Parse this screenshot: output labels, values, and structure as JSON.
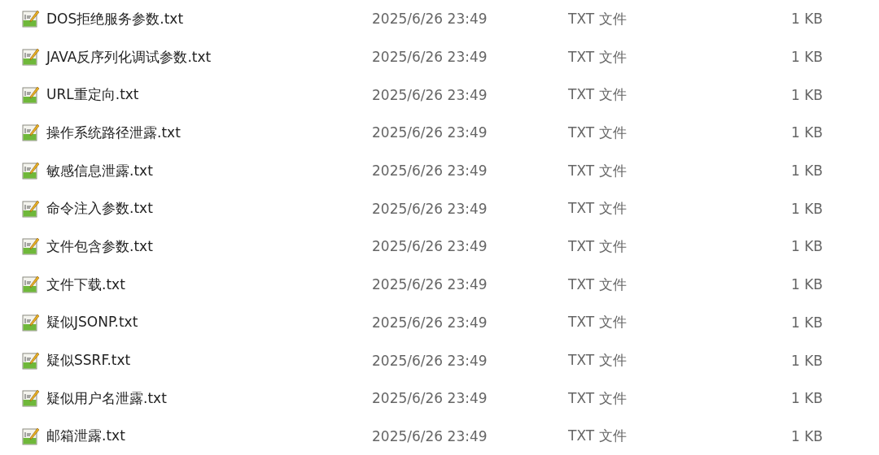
{
  "files": [
    {
      "name": "DOS拒绝服务参数.txt",
      "modified": "2025/6/26 23:49",
      "type": "TXT 文件",
      "size": "1 KB"
    },
    {
      "name": "JAVA反序列化调试参数.txt",
      "modified": "2025/6/26 23:49",
      "type": "TXT 文件",
      "size": "1 KB"
    },
    {
      "name": "URL重定向.txt",
      "modified": "2025/6/26 23:49",
      "type": "TXT 文件",
      "size": "1 KB"
    },
    {
      "name": "操作系统路径泄露.txt",
      "modified": "2025/6/26 23:49",
      "type": "TXT 文件",
      "size": "1 KB"
    },
    {
      "name": "敏感信息泄露.txt",
      "modified": "2025/6/26 23:49",
      "type": "TXT 文件",
      "size": "1 KB"
    },
    {
      "name": "命令注入参数.txt",
      "modified": "2025/6/26 23:49",
      "type": "TXT 文件",
      "size": "1 KB"
    },
    {
      "name": "文件包含参数.txt",
      "modified": "2025/6/26 23:49",
      "type": "TXT 文件",
      "size": "1 KB"
    },
    {
      "name": "文件下载.txt",
      "modified": "2025/6/26 23:49",
      "type": "TXT 文件",
      "size": "1 KB"
    },
    {
      "name": "疑似JSONP.txt",
      "modified": "2025/6/26 23:49",
      "type": "TXT 文件",
      "size": "1 KB"
    },
    {
      "name": "疑似SSRF.txt",
      "modified": "2025/6/26 23:49",
      "type": "TXT 文件",
      "size": "1 KB"
    },
    {
      "name": "疑似用户名泄露.txt",
      "modified": "2025/6/26 23:49",
      "type": "TXT 文件",
      "size": "1 KB"
    },
    {
      "name": "邮箱泄露.txt",
      "modified": "2025/6/26 23:49",
      "type": "TXT 文件",
      "size": "1 KB"
    }
  ]
}
